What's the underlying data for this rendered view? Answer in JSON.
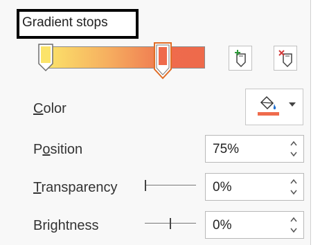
{
  "section": {
    "heading": "Gradient stops"
  },
  "gradient": {
    "colors": [
      "#fbe36a",
      "#ef6b4c"
    ],
    "stops": [
      {
        "position_percent": 0,
        "color": "#fbe36a",
        "selected": false
      },
      {
        "position_percent": 75,
        "color": "#ef6b4c",
        "selected": true
      }
    ]
  },
  "buttons": {
    "add_icon": "add-gradient-stop-icon",
    "remove_icon": "remove-gradient-stop-icon"
  },
  "color": {
    "label_prefix": "",
    "label_accel": "C",
    "label_rest": "olor",
    "current": "#ef6b4c",
    "icon": "paint-bucket-icon"
  },
  "position": {
    "label_prefix": "P",
    "label_accel": "o",
    "label_rest": "sition",
    "value": "75%"
  },
  "transparency": {
    "label_prefix": "",
    "label_accel": "T",
    "label_rest": "ransparency",
    "value": "0%",
    "slider_fraction": 0
  },
  "brightness": {
    "label_prefix": "Brightness",
    "value": "0%",
    "slider_fraction": 0.5
  }
}
